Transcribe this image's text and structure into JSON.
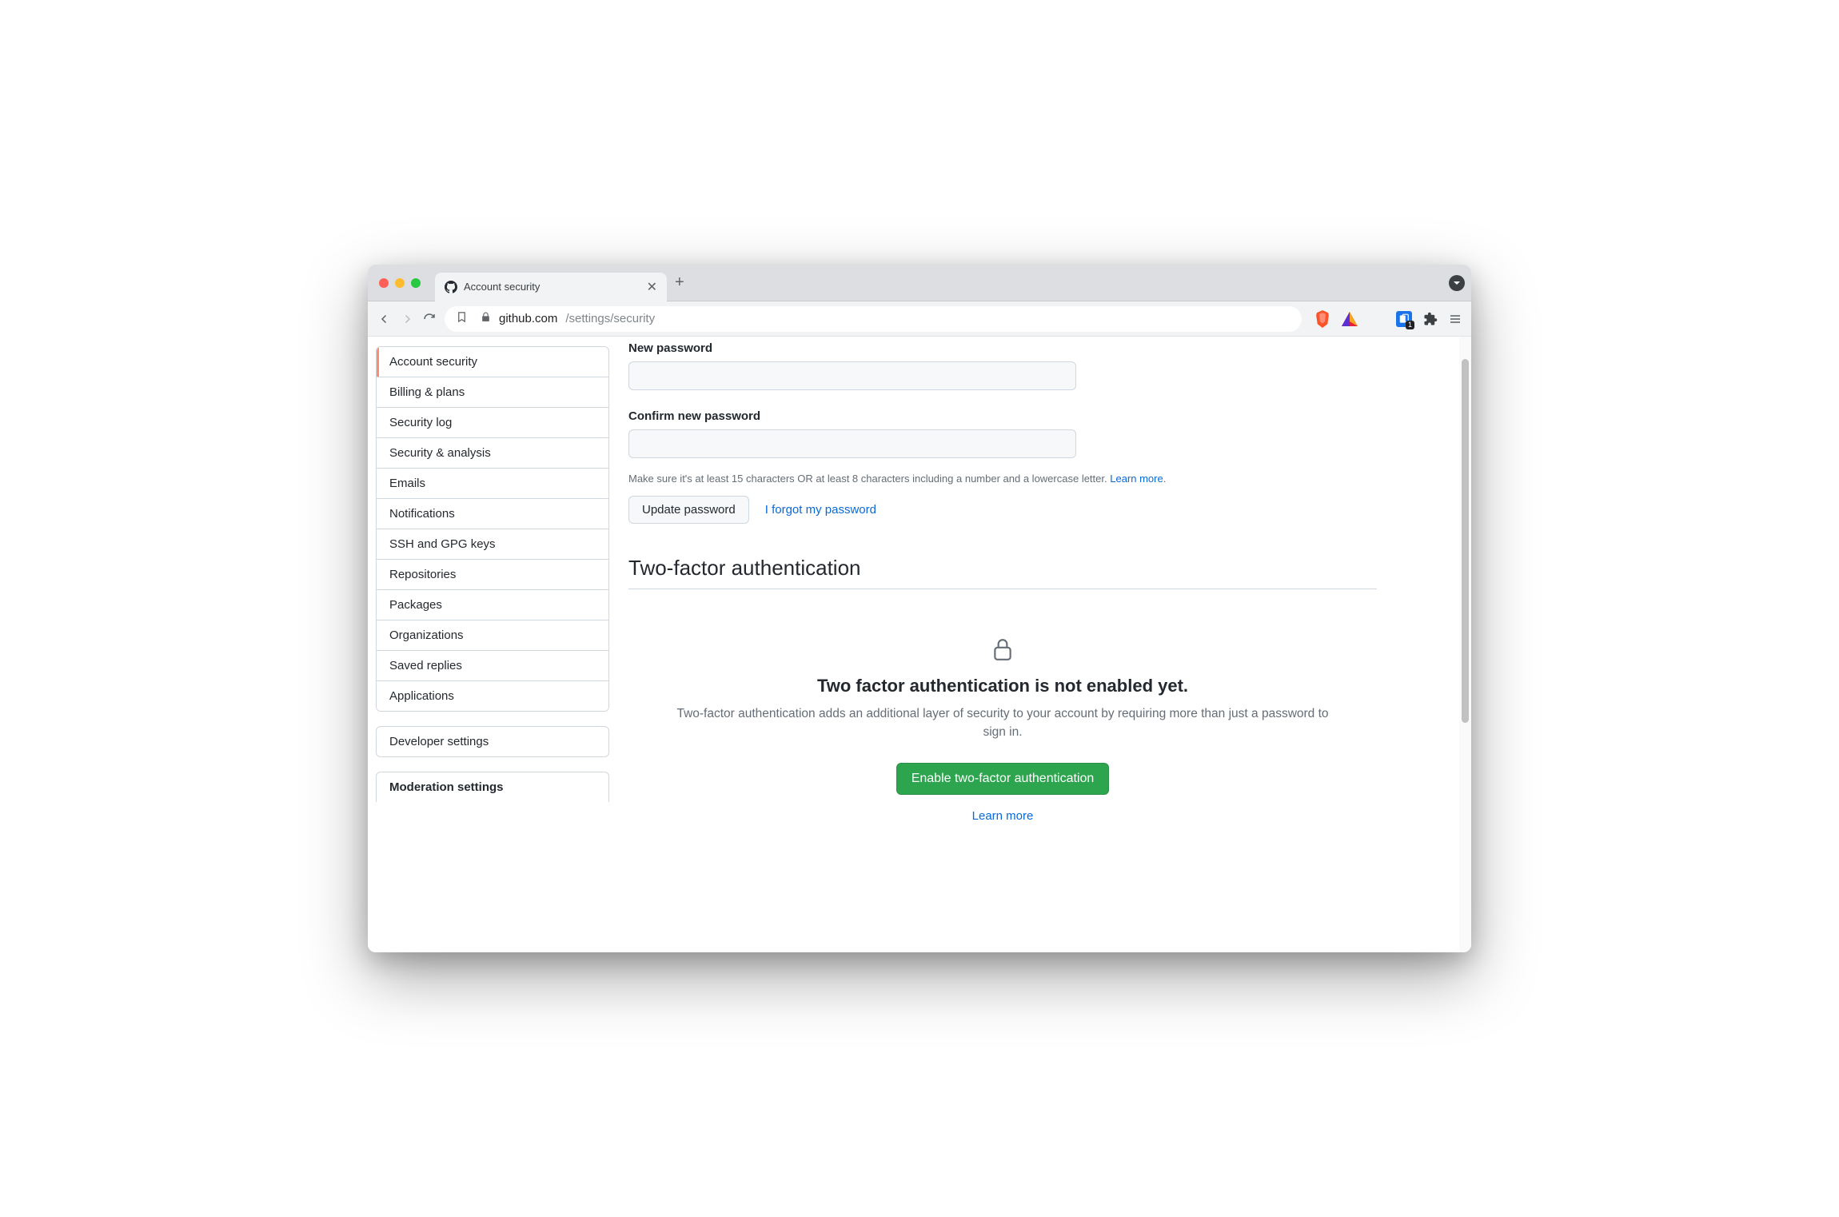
{
  "browser": {
    "tab_title": "Account security",
    "url_domain": "github.com",
    "url_path": "/settings/security",
    "ext_badge_count": "1"
  },
  "sidebar": {
    "items": [
      {
        "label": "Account security",
        "active": true
      },
      {
        "label": "Billing & plans"
      },
      {
        "label": "Security log"
      },
      {
        "label": "Security & analysis"
      },
      {
        "label": "Emails"
      },
      {
        "label": "Notifications"
      },
      {
        "label": "SSH and GPG keys"
      },
      {
        "label": "Repositories"
      },
      {
        "label": "Packages"
      },
      {
        "label": "Organizations"
      },
      {
        "label": "Saved replies"
      },
      {
        "label": "Applications"
      }
    ],
    "developer": "Developer settings",
    "moderation": "Moderation settings"
  },
  "password": {
    "new_label": "New password",
    "confirm_label": "Confirm new password",
    "hint": "Make sure it's at least 15 characters OR at least 8 characters including a number and a lowercase letter. ",
    "hint_link": "Learn more",
    "update_button": "Update password",
    "forgot_link": "I forgot my password"
  },
  "tfa": {
    "heading": "Two-factor authentication",
    "title": "Two factor authentication is not enabled yet.",
    "desc": "Two-factor authentication adds an additional layer of security to your account by requiring more than just a password to sign in.",
    "enable_button": "Enable two-factor authentication",
    "learn_more": "Learn more"
  }
}
